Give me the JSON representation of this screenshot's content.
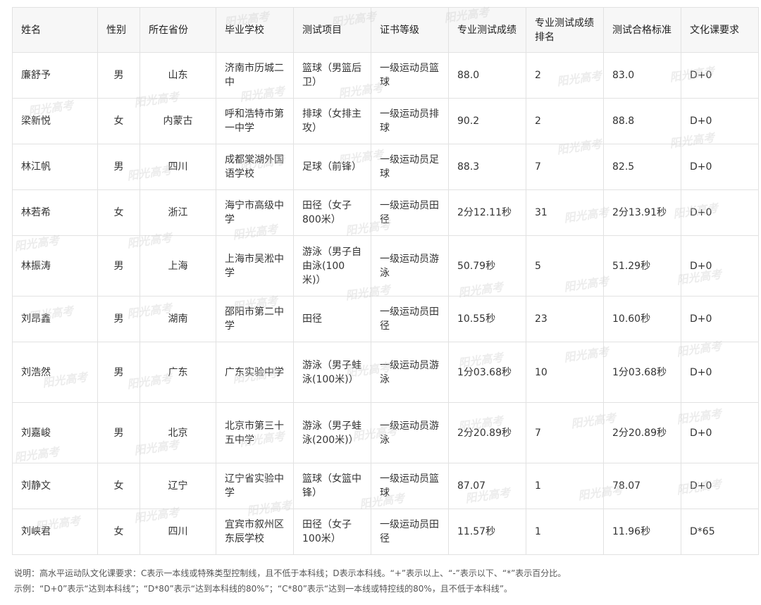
{
  "table": {
    "headers": [
      "姓名",
      "性别",
      "所在省份",
      "毕业学校",
      "测试项目",
      "证书等级",
      "专业测试成绩",
      "专业测试成绩排名",
      "测试合格标准",
      "文化课要求"
    ],
    "rows": [
      [
        "廉舒予",
        "男",
        "山东",
        "济南市历城二中",
        "篮球（男篮后卫）",
        "一级运动员篮球",
        "88.0",
        "2",
        "83.0",
        "D+0"
      ],
      [
        "梁新悦",
        "女",
        "内蒙古",
        "呼和浩特市第一中学",
        "排球（女排主攻）",
        "一级运动员排球",
        "90.2",
        "2",
        "88.8",
        "D+0"
      ],
      [
        "林江帆",
        "男",
        "四川",
        "成都棠湖外国语学校",
        "足球（前锋）",
        "一级运动员足球",
        "88.3",
        "7",
        "82.5",
        "D+0"
      ],
      [
        "林若希",
        "女",
        "浙江",
        "海宁市高级中学",
        "田径（女子800米）",
        "一级运动员田径",
        "2分12.11秒",
        "31",
        "2分13.91秒",
        "D+0"
      ],
      [
        "林振涛",
        "男",
        "上海",
        "上海市吴淞中学",
        "游泳（男子自由泳(100米)）",
        "一级运动员游泳",
        "50.79秒",
        "5",
        "51.29秒",
        "D+0"
      ],
      [
        "刘昂鑫",
        "男",
        "湖南",
        "邵阳市第二中学",
        "田径",
        "一级运动员田径",
        "10.55秒",
        "23",
        "10.60秒",
        "D+0"
      ],
      [
        "刘浩然",
        "男",
        "广东",
        "广东实验中学",
        "游泳（男子蛙泳(100米)）",
        "一级运动员游泳",
        "1分03.68秒",
        "10",
        "1分03.68秒",
        "D+0"
      ],
      [
        "刘嘉峻",
        "男",
        "北京",
        "北京市第三十五中学",
        "游泳（男子蛙泳(200米)）",
        "一级运动员游泳",
        "2分20.89秒",
        "7",
        "2分20.89秒",
        "D+0"
      ],
      [
        "刘静文",
        "女",
        "辽宁",
        "辽宁省实验中学",
        "篮球（女篮中锋）",
        "一级运动员篮球",
        "87.07",
        "1",
        "78.07",
        "D+0"
      ],
      [
        "刘峡君",
        "女",
        "四川",
        "宜宾市叙州区东辰学校",
        "田径（女子100米）",
        "一级运动员田径",
        "11.57秒",
        "1",
        "11.96秒",
        "D*65"
      ]
    ]
  },
  "notes": {
    "line1": "说明：高水平运动队文化课要求：C表示一本线或特殊类型控制线，且不低于本科线；D表示本科线。“+”表示以上、“-”表示以下、“*”表示百分比。",
    "line2": "示例：“D+0”表示“达到本科线”；“D*80”表示“达到本科线的80%”；“C*80”表示“达到一本线或特控线的80%，且不低于本科线”。"
  },
  "watermark_text": "阳光高考",
  "colors": {
    "header_bg": "#f7f7f7",
    "border": "#e2e2e2",
    "text": "#333333"
  }
}
